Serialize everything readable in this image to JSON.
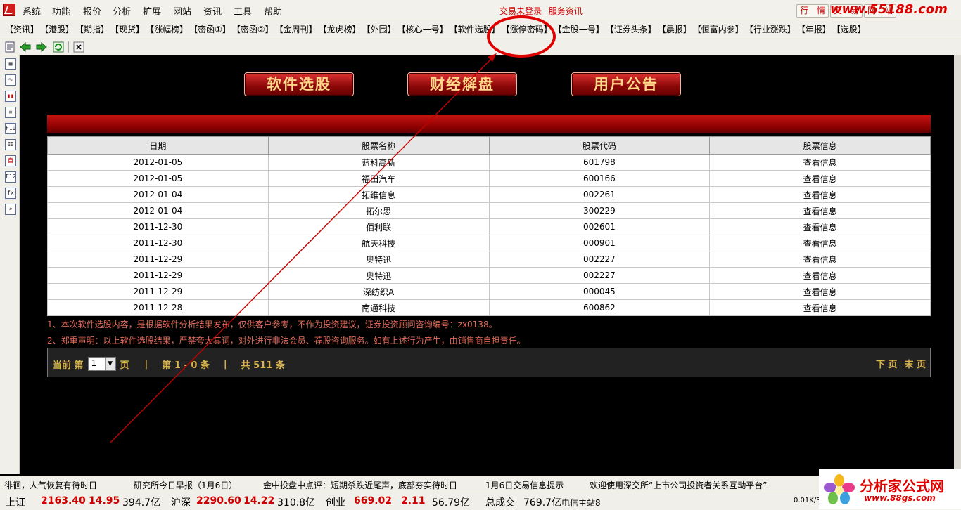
{
  "menubar": {
    "items": [
      "系统",
      "功能",
      "报价",
      "分析",
      "扩展",
      "网站",
      "资讯",
      "工具",
      "帮助"
    ],
    "trade_links": [
      "交易未登录",
      "服务资讯"
    ],
    "right_tabs": [
      "行　情",
      "交　易",
      "网　站"
    ],
    "watermark": "www.55188.com"
  },
  "tabs": [
    "【资讯】",
    "【港股】",
    "【期指】",
    "【现货】",
    "【涨幅榜】",
    "【密函①】",
    "【密函②】",
    "【金周刊】",
    "【龙虎榜】",
    "【外围】",
    "【核心一号】",
    "【软件选股】",
    "【涨停密码】",
    "【金股一号】",
    "【证券头条】",
    "【晨报】",
    "【恒富内参】",
    "【行业涨跌】",
    "【年报】",
    "【选股】"
  ],
  "active_tab": "【软件选股】",
  "sidebar": {
    "buttons": [
      "▦",
      "∿",
      "▮▮",
      "≡",
      "F10",
      "☷",
      "自",
      "F12",
      "fx",
      "⌕"
    ]
  },
  "content": {
    "buttons": [
      "软件选股",
      "财经解盘",
      "用户公告"
    ],
    "table": {
      "headers": [
        "日期",
        "股票名称",
        "股票代码",
        "股票信息"
      ],
      "rows": [
        [
          "2012-01-05",
          "蓝科高新",
          "601798",
          "查看信息"
        ],
        [
          "2012-01-05",
          "福田汽车",
          "600166",
          "查看信息"
        ],
        [
          "2012-01-04",
          "拓维信息",
          "002261",
          "查看信息"
        ],
        [
          "2012-01-04",
          "拓尔思",
          "300229",
          "查看信息"
        ],
        [
          "2011-12-30",
          "佰利联",
          "002601",
          "查看信息"
        ],
        [
          "2011-12-30",
          "航天科技",
          "000901",
          "查看信息"
        ],
        [
          "2011-12-29",
          "奥特迅",
          "002227",
          "查看信息"
        ],
        [
          "2011-12-29",
          "奥特迅",
          "002227",
          "查看信息"
        ],
        [
          "2011-12-29",
          "深纺织A",
          "000045",
          "查看信息"
        ],
        [
          "2011-12-28",
          "南通科技",
          "600862",
          "查看信息"
        ]
      ]
    },
    "disclaimers": [
      "1、本次软件选股内容，是根据软件分析结果发布，仅供客户参考，不作为投资建议，证券投资顾问咨询编号：zx0138。",
      "2、郑重声明：以上软件选股结果，严禁夸大其词，对外进行非法会员、荐股咨询服务。如有上述行为产生，由销售商自担责任。"
    ],
    "pager": {
      "current_label": "当前 第",
      "page_value": "1",
      "page_unit": "页",
      "sep1": "|",
      "range": "第 1 - 0 条",
      "sep2": "|",
      "total": "共 511 条",
      "next": "下 页",
      "last": "末 页"
    }
  },
  "ticker": [
    "徘徊，人气恢复有待时日",
    "研究所今日早报（1月6日）",
    "金中投盘中点评：短期杀跌近尾声，底部夯实待时日",
    "1月6日交易信息提示",
    "欢迎使用深交所“上市公司投资者关系互动平台”"
  ],
  "indexbar": {
    "sh_label": "上证",
    "sh_value": "2163.40",
    "sh_change": "14.95",
    "sh_amount": "394.7亿",
    "hs_label": "沪深",
    "hs_value": "2290.60",
    "hs_change": "14.22",
    "hs_amount": "310.8亿",
    "cy_label": "创业",
    "cy_value": "669.02",
    "cy_change": "2.11",
    "cy_amount": "56.79亿",
    "total_label": "总成交",
    "total_amount": "769.7亿",
    "server": "电信主站8",
    "net_speed": "0.01K/S"
  },
  "brand": {
    "name": "分析家公式网",
    "url": "www.88gs.com"
  }
}
